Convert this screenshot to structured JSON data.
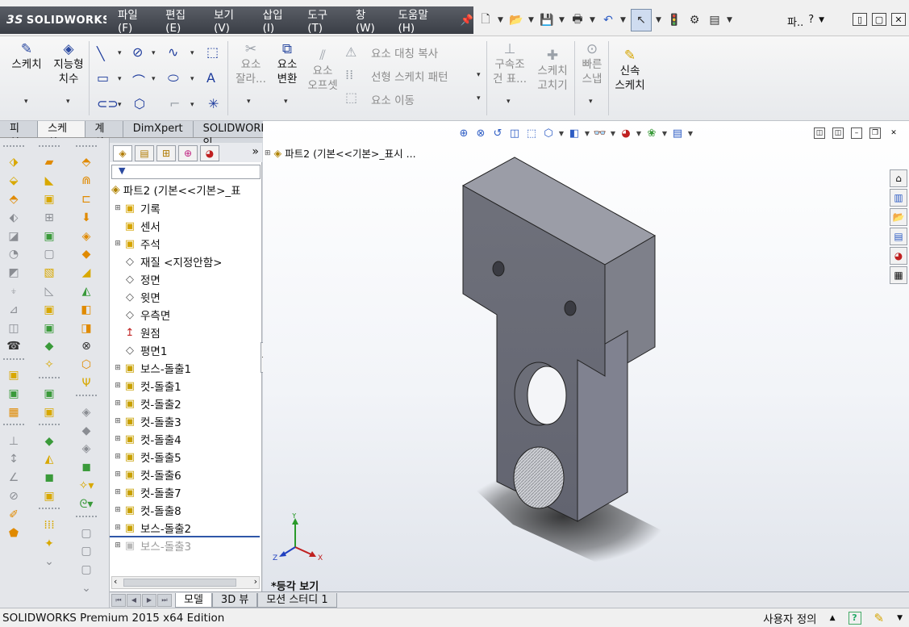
{
  "app": {
    "logo_text": "SOLIDWORKS",
    "logo_mark": "3S"
  },
  "menu": {
    "items": [
      "파일(F)",
      "편집(E)",
      "보기(V)",
      "삽입(I)",
      "도구(T)",
      "창(W)",
      "도움말(H)"
    ]
  },
  "help_area": {
    "search_label": "파..",
    "question": "?"
  },
  "ribbon": {
    "sketch": "스케치",
    "smart_dim_line1": "지능형",
    "smart_dim_line2": "치수",
    "trim_line1": "요소",
    "trim_line2": "잘라...",
    "convert_line1": "요소",
    "convert_line2": "변환",
    "offset_line1": "요소",
    "offset_line2": "오프셋",
    "mirror": "요소 대칭 복사",
    "linear_pattern": "선형 스케치 패턴",
    "move": "요소 이동",
    "relations_line1": "구속조",
    "relations_line2": "건 표...",
    "repair_line1": "스케치",
    "repair_line2": "고치기",
    "quick_snap_line1": "빠른",
    "quick_snap_line2": "스냅",
    "rapid_line1": "신속",
    "rapid_line2": "스케치"
  },
  "command_tabs": [
    "피처",
    "스케치",
    "계산",
    "DimXpert",
    "SOLIDWORKS 애드인"
  ],
  "feature_manager": {
    "root": "파트2  (기본<<기본>_표",
    "more": "»",
    "items": [
      {
        "label": "기록",
        "icon": "history-folder-icon",
        "expand": true,
        "kind": "fold"
      },
      {
        "label": "센서",
        "icon": "sensor-folder-icon",
        "expand": false,
        "kind": "fold"
      },
      {
        "label": "주석",
        "icon": "annotation-folder-icon",
        "expand": true,
        "kind": "fold"
      },
      {
        "label": "재질 <지정안함>",
        "icon": "material-icon",
        "expand": false,
        "kind": "plane"
      },
      {
        "label": "정면",
        "icon": "plane-icon",
        "expand": false,
        "kind": "plane"
      },
      {
        "label": "윗면",
        "icon": "plane-icon",
        "expand": false,
        "kind": "plane"
      },
      {
        "label": "우측면",
        "icon": "plane-icon",
        "expand": false,
        "kind": "plane"
      },
      {
        "label": "원점",
        "icon": "origin-icon",
        "expand": false,
        "kind": "origin"
      },
      {
        "label": "평면1",
        "icon": "plane-icon",
        "expand": false,
        "kind": "plane"
      },
      {
        "label": "보스-돌출1",
        "icon": "boss-extrude-icon",
        "expand": true,
        "kind": "feat"
      },
      {
        "label": "컷-돌출1",
        "icon": "cut-extrude-icon",
        "expand": true,
        "kind": "feat"
      },
      {
        "label": "컷-돌출2",
        "icon": "cut-extrude-icon",
        "expand": true,
        "kind": "feat"
      },
      {
        "label": "컷-돌출3",
        "icon": "cut-extrude-icon",
        "expand": true,
        "kind": "feat"
      },
      {
        "label": "컷-돌출4",
        "icon": "cut-extrude-icon",
        "expand": true,
        "kind": "feat"
      },
      {
        "label": "컷-돌출5",
        "icon": "cut-extrude-icon",
        "expand": true,
        "kind": "feat"
      },
      {
        "label": "컷-돌출6",
        "icon": "cut-extrude-icon",
        "expand": true,
        "kind": "feat"
      },
      {
        "label": "컷-돌출7",
        "icon": "cut-extrude-icon",
        "expand": true,
        "kind": "feat"
      },
      {
        "label": "컷-돌출8",
        "icon": "cut-extrude-icon",
        "expand": true,
        "kind": "feat"
      },
      {
        "label": "보스-돌출2",
        "icon": "boss-extrude-icon",
        "expand": true,
        "kind": "feat"
      },
      {
        "label": "보스-돌출3",
        "icon": "boss-extrude-icon",
        "expand": true,
        "kind": "dim"
      }
    ]
  },
  "viewport": {
    "tree_label": "파트2  (기본<<기본>_표시 ...",
    "view_name": "*등각 보기",
    "triad": {
      "x": "X",
      "y": "Y",
      "z": "Z"
    }
  },
  "bottom_tabs": [
    "모델",
    "3D 뷰",
    "모션 스터디 1"
  ],
  "status": {
    "left": "SOLIDWORKS Premium 2015 x64 Edition",
    "right": "사용자 정의"
  },
  "colors": {
    "part_face_top": "#9a9ca6",
    "part_face_front": "#6d6f79",
    "part_face_side": "#80828c",
    "accent": "#2b4aa0"
  }
}
